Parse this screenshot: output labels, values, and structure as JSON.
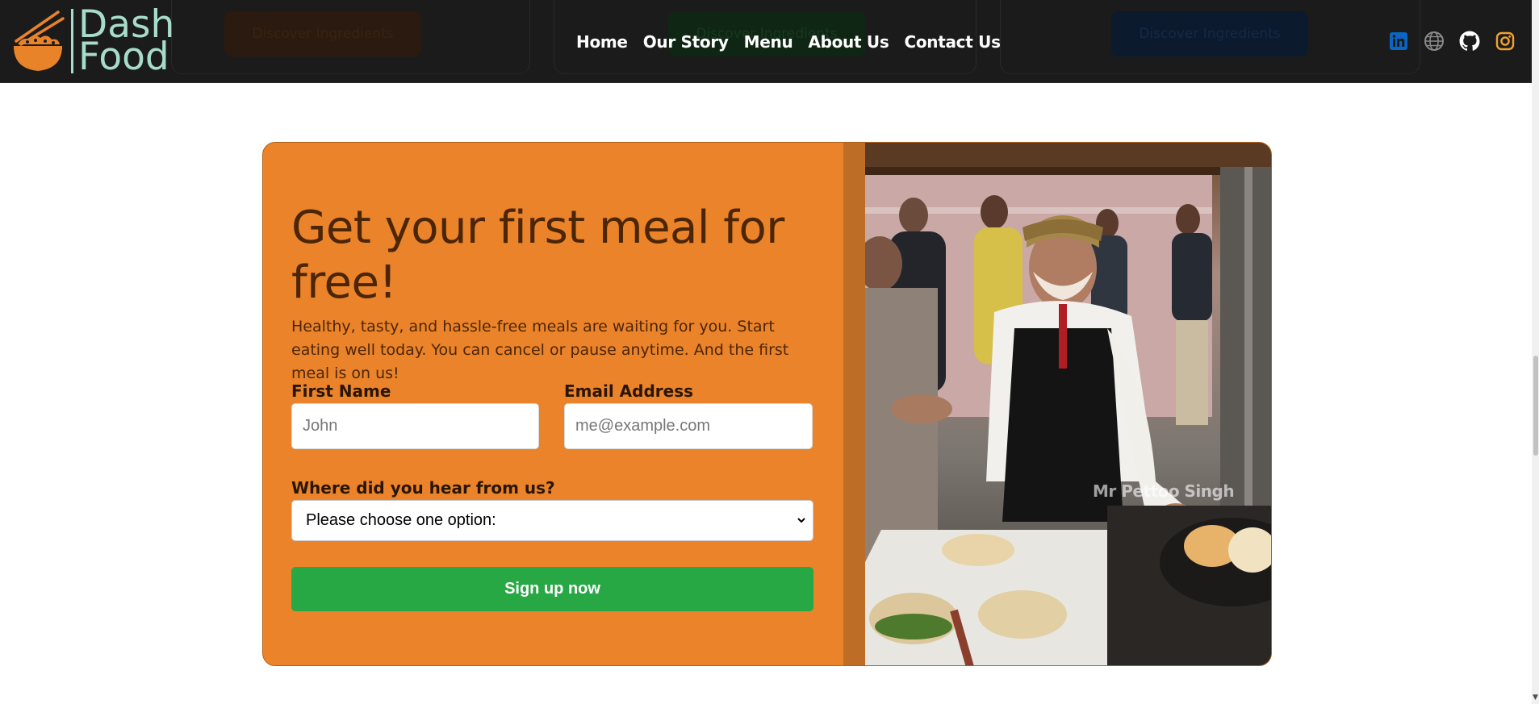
{
  "brand": {
    "line1": "Dash",
    "line2": "Food",
    "accent": "#a7dccb",
    "bowl_color": "#e8832a"
  },
  "header": {
    "ghost_buttons": [
      "Discover Ingredients",
      "Discover Ingredients",
      "Discover Ingredients"
    ],
    "nav": [
      {
        "label": "Home"
      },
      {
        "label": "Our Story"
      },
      {
        "label": "Menu"
      },
      {
        "label": "About Us"
      },
      {
        "label": "Contact Us"
      }
    ],
    "social": [
      {
        "name": "linkedin-icon",
        "color": "#0a66c2"
      },
      {
        "name": "globe-icon",
        "color": "#8a8a8a"
      },
      {
        "name": "github-icon",
        "color": "#ffffff"
      },
      {
        "name": "instagram-icon",
        "color": "#f0a030"
      }
    ]
  },
  "signup": {
    "headline": "Get your first meal for free!",
    "lede": "Healthy, tasty, and hassle-free meals are waiting for you. Start eating well today. You can cancel or pause anytime. And the first meal is on us!",
    "first_name_label": "First Name",
    "first_name_placeholder": "John",
    "email_label": "Email Address",
    "email_placeholder": "me@example.com",
    "source_label": "Where did you hear from us?",
    "source_selected": "Please choose one option:",
    "submit_label": "Sign up now",
    "photo_watermark": "Mr Pettoo Singh",
    "colors": {
      "panel": "#ea8329",
      "band": "#bd6d26",
      "button": "#27a844",
      "heading": "#4a2506"
    }
  }
}
